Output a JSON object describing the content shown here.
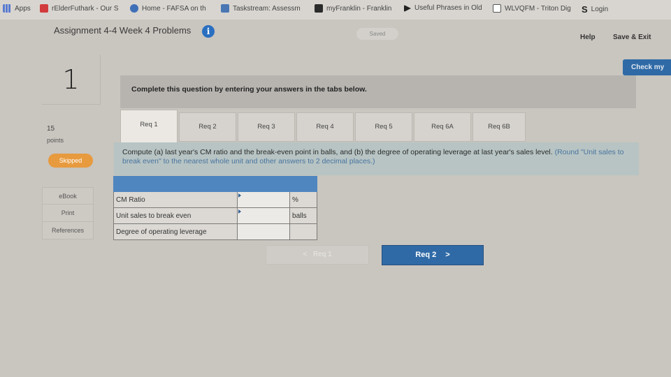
{
  "bookmarks": [
    {
      "label": "Apps",
      "icon": "apps-icon"
    },
    {
      "label": "rElderFuthark - Our S",
      "icon": "site-icon"
    },
    {
      "label": "Home - FAFSA on th",
      "icon": "globe-icon"
    },
    {
      "label": "Taskstream: Assessm",
      "icon": "taskstream-icon"
    },
    {
      "label": "myFranklin - Franklin",
      "icon": "franklin-icon"
    },
    {
      "label": "Useful Phrases in Old",
      "icon": "arrow-icon"
    },
    {
      "label": "WLVQFM - Triton Dig",
      "icon": "document-icon"
    },
    {
      "label": "Login",
      "icon": "s-logo-icon"
    }
  ],
  "header": {
    "title": "Assignment 4-4 Week 4 Problems",
    "info_glyph": "i",
    "saved": "Saved",
    "help": "Help",
    "save_exit": "Save & Exit",
    "check_my": "Check my"
  },
  "question": {
    "number": "1",
    "points_value": "15",
    "points_label": "points",
    "status": "Skipped"
  },
  "side_links": [
    "eBook",
    "Print",
    "References"
  ],
  "banner": "Complete this question by entering your answers in the tabs below.",
  "tabs": [
    "Req 1",
    "Req 2",
    "Req 3",
    "Req 4",
    "Req 5",
    "Req 6A",
    "Req 6B"
  ],
  "active_tab": "Req 1",
  "instruction": {
    "main": "Compute (a) last year's CM ratio and the break-even point in balls, and (b) the degree of operating leverage at last year's sales level.",
    "hint": "(Round \"Unit sales to break even\" to the nearest whole unit and other answers to 2 decimal places.)"
  },
  "answer_rows": [
    {
      "label": "CM Ratio",
      "value": "",
      "unit": "%"
    },
    {
      "label": "Unit sales to break even",
      "value": "",
      "unit": "balls"
    },
    {
      "label": "Degree of operating leverage",
      "value": "",
      "unit": ""
    }
  ],
  "nav": {
    "prev_label": "Req 1",
    "prev_glyph": "<",
    "next_label": "Req 2",
    "next_glyph": ">"
  },
  "colors": {
    "accent": "#2f6aa6",
    "table_header": "#4f86bf",
    "skipped": "#e79a3e",
    "hint": "#4a74a0"
  }
}
